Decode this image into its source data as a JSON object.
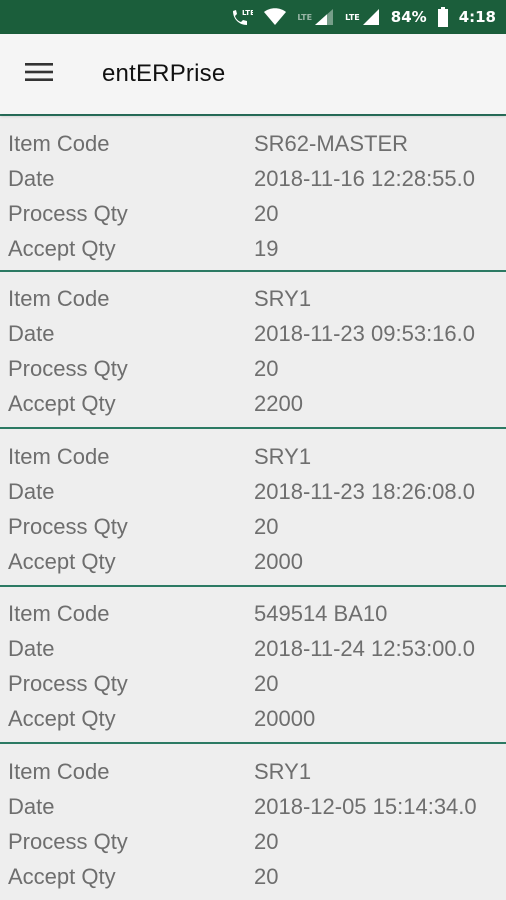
{
  "status_bar": {
    "battery": "84%",
    "time": "4:18",
    "icons": [
      "lte-call-icon",
      "wifi-icon",
      "lte-signal-icon",
      "signal-icon",
      "battery-icon"
    ],
    "lte_label": "LTE",
    "lte_label_2": "LTE",
    "color": "#1b5e3b"
  },
  "app_bar": {
    "title": "entERPrise",
    "menu_icon": "hamburger-menu-icon"
  },
  "labels": {
    "item_code": "Item Code",
    "date": "Date",
    "process_qty": "Process Qty",
    "accept_qty": "Accept Qty"
  },
  "records": [
    {
      "item_code": "SR62-MASTER",
      "date": "2018-11-16 12:28:55.0",
      "process_qty": "20",
      "accept_qty": "19"
    },
    {
      "item_code": "SRY1",
      "date": "2018-11-23 09:53:16.0",
      "process_qty": "20",
      "accept_qty": "2200"
    },
    {
      "item_code": "SRY1",
      "date": "2018-11-23 18:26:08.0",
      "process_qty": "20",
      "accept_qty": "2000"
    },
    {
      "item_code": "549514 BA10",
      "date": "2018-11-24 12:53:00.0",
      "process_qty": "20",
      "accept_qty": "20000"
    },
    {
      "item_code": "SRY1",
      "date": "2018-12-05 15:14:34.0",
      "process_qty": "20",
      "accept_qty": "20"
    }
  ],
  "colors": {
    "divider": "#2c7a63",
    "text": "#6e6e6e"
  }
}
